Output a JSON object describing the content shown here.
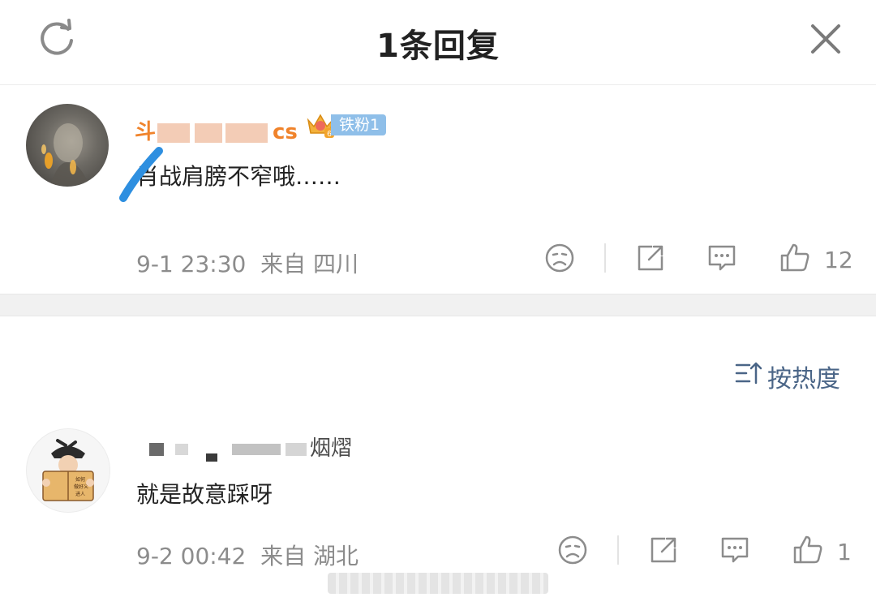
{
  "header": {
    "title": "1条回复",
    "refresh_icon": "refresh-icon",
    "close_icon": "close-icon"
  },
  "main_comment": {
    "username_visible_start": "斗",
    "username_visible_end": "cs",
    "badge": {
      "icon": "crown-icon",
      "level": "6",
      "label": "铁粉1",
      "color": "#8fbfe9"
    },
    "text": "肖战肩膀不窄哦……",
    "time": "9-1 23:30",
    "location": "来自 四川",
    "like_count": "12"
  },
  "sort": {
    "label": "按热度",
    "icon": "sort-icon"
  },
  "reply": {
    "username_visible": "烟熠",
    "avatar_book_text": "如何做好义进人",
    "text": "就是故意踩呀",
    "time": "9-2 00:42",
    "location": "来自 湖北",
    "like_count": "1"
  },
  "colors": {
    "username_orange": "#f0832b",
    "meta_gray": "#8c8c8c",
    "sort_blue": "#4a6587",
    "pen_blue": "#2e8fe0"
  }
}
